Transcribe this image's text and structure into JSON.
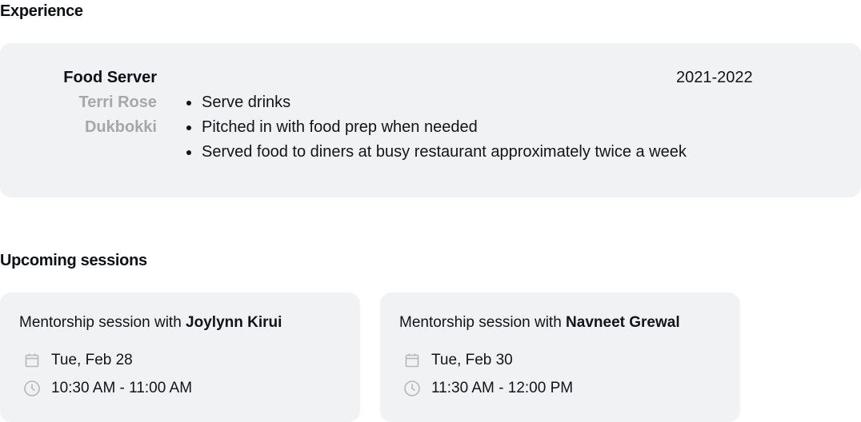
{
  "experience": {
    "title": "Experience",
    "role": "Food Server",
    "person": "Terri Rose",
    "company": "Dukbokki",
    "years": "2021-2022",
    "bullets": [
      "Serve drinks",
      "Pitched in with food prep when needed",
      "Served food to diners at busy restaurant approximately twice a week"
    ]
  },
  "sessions": {
    "title": "Upcoming sessions",
    "items": [
      {
        "prefix": "Mentorship session with",
        "mentor": "Joylynn Kirui",
        "date": "Tue, Feb 28",
        "time": "10:30 AM - 11:00 AM",
        "date_icon": "calendar-icon",
        "time_icon": "clock-icon"
      },
      {
        "prefix": "Mentorship session with",
        "mentor": "Navneet Grewal",
        "date": "Tue, Feb 30",
        "time": "11:30 AM - 12:00 PM",
        "date_icon": "calendar-icon",
        "time_icon": "clock-icon"
      }
    ]
  },
  "colors": {
    "card_bg": "#f1f2f4",
    "muted_text": "#a5a7ab",
    "icon": "#b4b7bc"
  }
}
